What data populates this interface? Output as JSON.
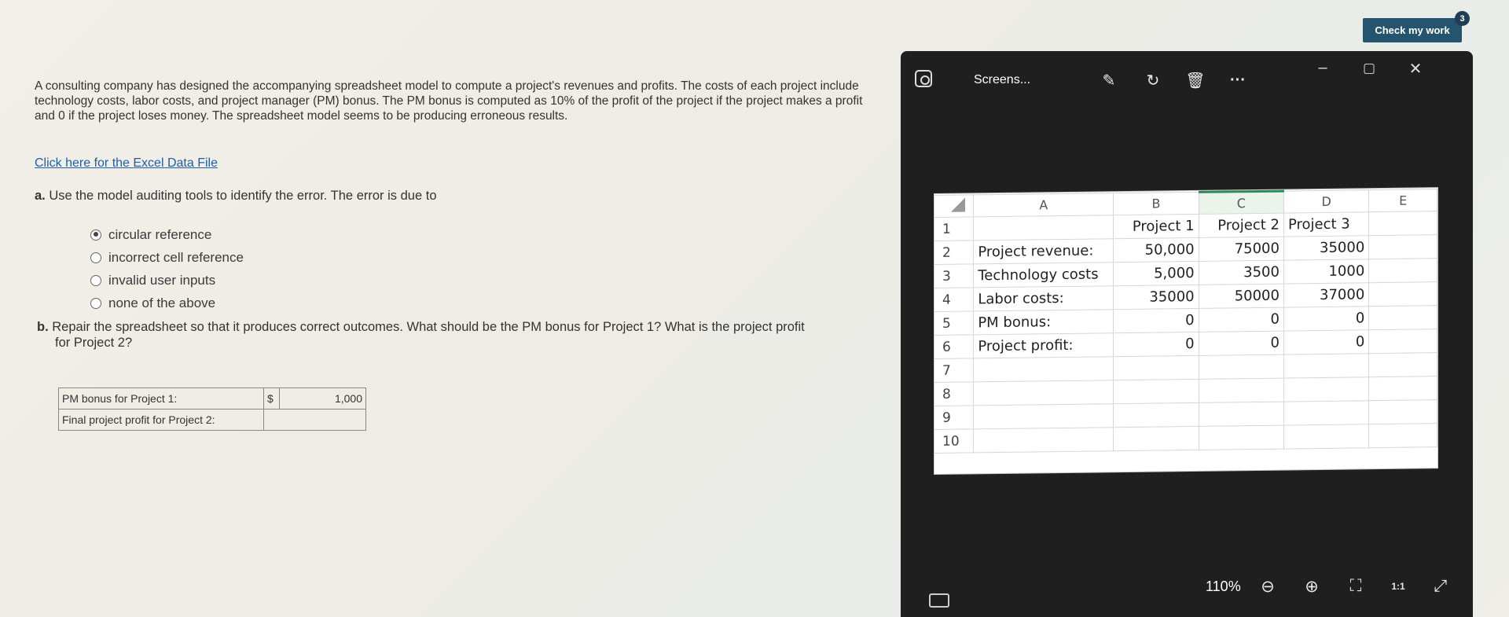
{
  "question": {
    "intro": "A consulting company has designed the accompanying spreadsheet model to compute a project's revenues and profits. The costs of each project include technology costs, labor costs, and project manager (PM) bonus. The PM bonus is computed as 10% of the profit of the project if the project makes a profit and 0 if the project loses money. The spreadsheet model seems to be producing erroneous results.",
    "excel_link": "Click here for the Excel Data File",
    "part_a_letter": "a.",
    "part_a_text": "Use the model auditing tools to identify the error. The error is due to",
    "options": [
      "circular reference",
      "incorrect cell reference",
      "invalid user inputs",
      "none of the above"
    ],
    "selected_option": 0,
    "part_b_letter": "b.",
    "part_b_line1": "Repair the spreadsheet so that it produces correct outcomes. What should be the PM bonus for Project 1? What is the project profit",
    "part_b_line2": "for Project 2?",
    "answers": [
      {
        "label": "PM bonus for Project 1:",
        "currency": "$",
        "value": "1,000"
      },
      {
        "label": "Final project profit for Project 2:",
        "currency": "",
        "value": ""
      }
    ]
  },
  "check_button": {
    "label": "Check my work",
    "badge": "3"
  },
  "viewer": {
    "title": "Screens...",
    "zoom": "110%",
    "icons": [
      "edit-icon",
      "rotate-icon",
      "delete-icon",
      "more-icon"
    ],
    "window_controls": [
      "minimize-icon",
      "maximize-icon",
      "close-icon"
    ]
  },
  "sheet": {
    "columns": [
      "A",
      "B",
      "C",
      "D",
      "E"
    ],
    "rows": [
      {
        "n": "1",
        "a": "",
        "b": "Project 1",
        "c": "Project 2",
        "d": "Project 3"
      },
      {
        "n": "2",
        "a": "Project revenue:",
        "b": "50,000",
        "c": "75000",
        "d": "35000"
      },
      {
        "n": "3",
        "a": "Technology costs",
        "b": "5,000",
        "c": "3500",
        "d": "1000"
      },
      {
        "n": "4",
        "a": "Labor costs:",
        "b": "35000",
        "c": "50000",
        "d": "37000"
      },
      {
        "n": "5",
        "a": "PM bonus:",
        "b": "0",
        "c": "0",
        "d": "0"
      },
      {
        "n": "6",
        "a": "Project profit:",
        "b": "0",
        "c": "0",
        "d": "0"
      },
      {
        "n": "7",
        "a": "",
        "b": "",
        "c": "",
        "d": ""
      },
      {
        "n": "8",
        "a": "",
        "b": "",
        "c": "",
        "d": ""
      },
      {
        "n": "9",
        "a": "",
        "b": "",
        "c": "",
        "d": ""
      },
      {
        "n": "10",
        "a": "",
        "b": "",
        "c": "",
        "d": ""
      }
    ]
  }
}
